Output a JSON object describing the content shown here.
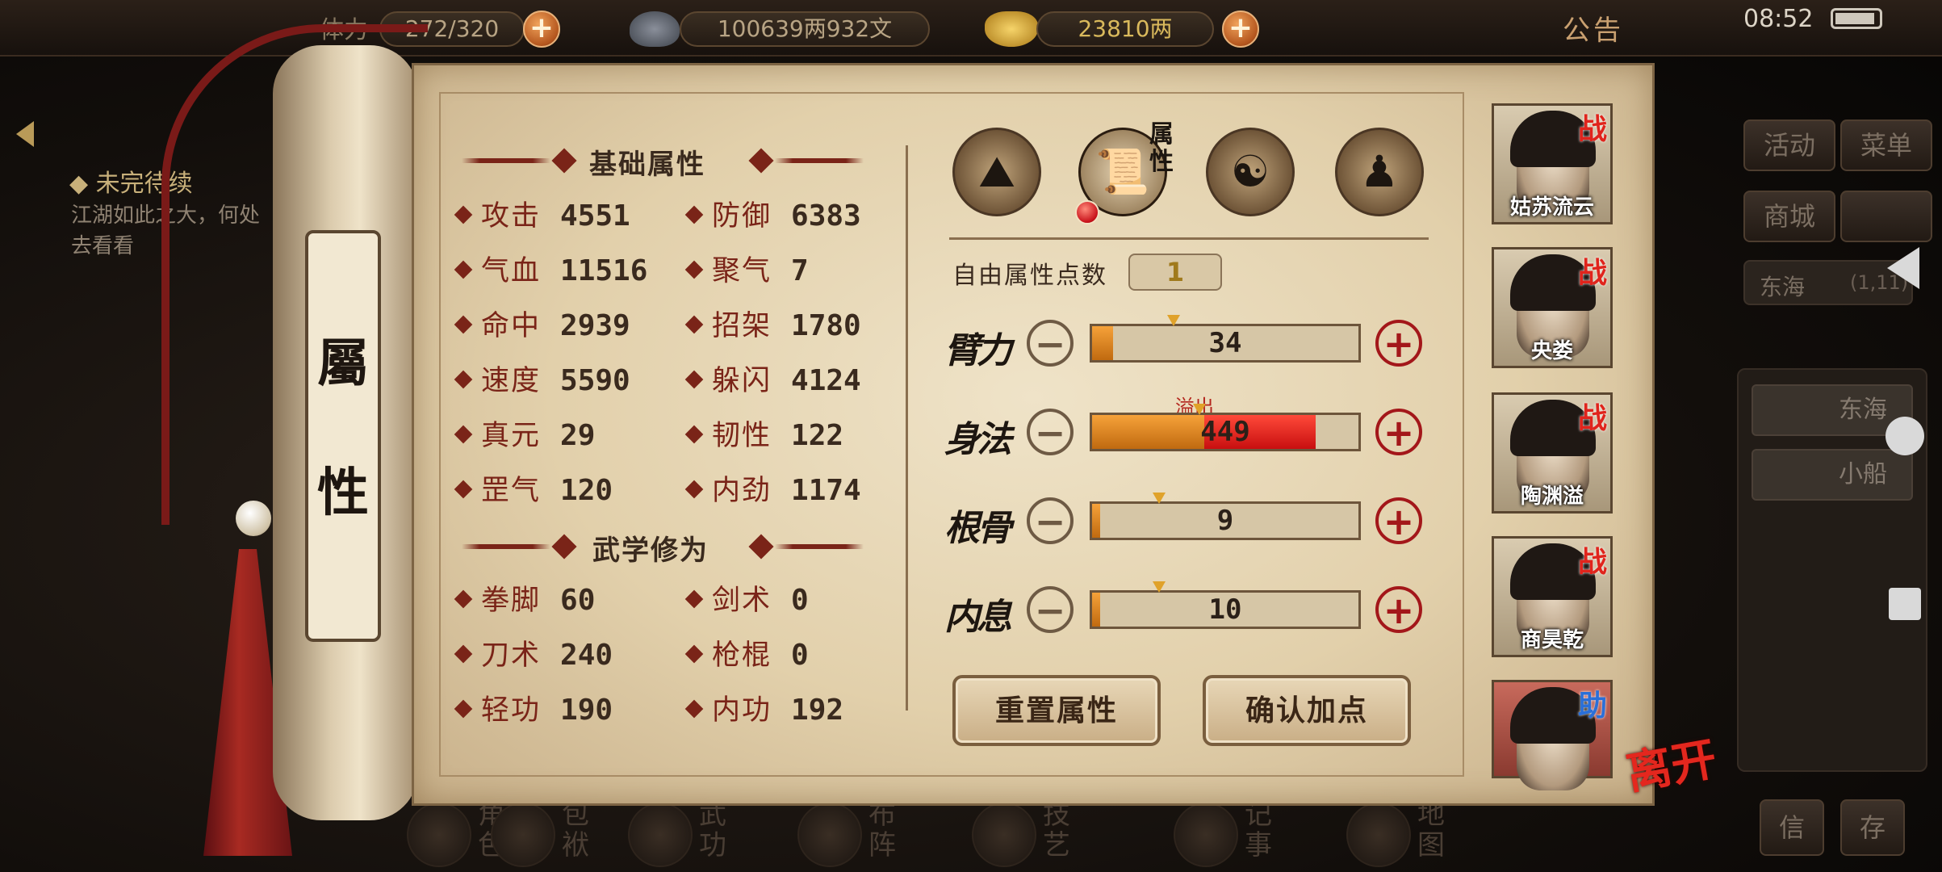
{
  "topbar": {
    "stamina_label": "体力",
    "stamina_value": "272/320",
    "silver_value": "100639两932文",
    "gold_value": "23810两",
    "notice": "公告",
    "clock": "08:52"
  },
  "quest": {
    "title": "◆ 未完待续",
    "text": "江湖如此之大，何处去看看"
  },
  "scroll": {
    "label_top": "屬",
    "label_bottom": "性"
  },
  "basic": {
    "title": "基础属性",
    "stats": [
      {
        "key": "攻击",
        "value": "4551"
      },
      {
        "key": "防御",
        "value": "6383"
      },
      {
        "key": "气血",
        "value": "11516"
      },
      {
        "key": "聚气",
        "value": "7"
      },
      {
        "key": "命中",
        "value": "2939"
      },
      {
        "key": "招架",
        "value": "1780"
      },
      {
        "key": "速度",
        "value": "5590"
      },
      {
        "key": "躲闪",
        "value": "4124"
      },
      {
        "key": "真元",
        "value": "29"
      },
      {
        "key": "韧性",
        "value": "122"
      },
      {
        "key": "罡气",
        "value": "120"
      },
      {
        "key": "内劲",
        "value": "1174"
      }
    ]
  },
  "martial": {
    "title": "武学修为",
    "stats": [
      {
        "key": "拳脚",
        "value": "60"
      },
      {
        "key": "剑术",
        "value": "0"
      },
      {
        "key": "刀术",
        "value": "240"
      },
      {
        "key": "枪棍",
        "value": "0"
      },
      {
        "key": "轻功",
        "value": "190"
      },
      {
        "key": "内功",
        "value": "192"
      }
    ]
  },
  "tabs": {
    "attr_label": "属性"
  },
  "points": {
    "free_label": "自由属性点数",
    "free_value": "1",
    "overflow_label": "溢出",
    "attributes": [
      {
        "name": "臂力",
        "value": "34",
        "fill": 0.08,
        "over": 0
      },
      {
        "name": "身法",
        "value": "449",
        "fill": 0.42,
        "over": 0.42
      },
      {
        "name": "根骨",
        "value": "9",
        "fill": 0.03,
        "over": 0
      },
      {
        "name": "内息",
        "value": "10",
        "fill": 0.03,
        "over": 0
      }
    ]
  },
  "buttons": {
    "reset": "重置属性",
    "confirm": "确认加点"
  },
  "characters": [
    {
      "name": "姑苏流云",
      "tag": "战"
    },
    {
      "name": "央娄",
      "tag": "战"
    },
    {
      "name": "陶渊溢",
      "tag": "战"
    },
    {
      "name": "商昊乾",
      "tag": "战"
    },
    {
      "name": "",
      "tag": "助"
    }
  ],
  "leave": "离开",
  "side_menu": {
    "activity": "活动",
    "menu": "菜单",
    "shop": "商城",
    "region_name": "东海",
    "region_coord": "(1,11)",
    "locations": [
      "东海",
      "小船"
    ],
    "bottom_right": [
      "信",
      "存"
    ]
  },
  "bottom_menu": [
    "角色",
    "包袱",
    "武功",
    "布阵",
    "技艺",
    "记事",
    "地图"
  ],
  "colors": {
    "accent_red": "#7a2418",
    "bar_orange": "#f6a23a",
    "overflow_red": "#c80f10"
  }
}
